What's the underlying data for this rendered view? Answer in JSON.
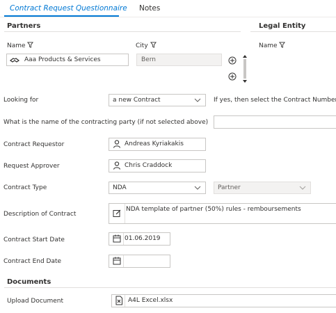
{
  "tabs": [
    {
      "label": "Contract Request Questionnaire",
      "active": true
    },
    {
      "label": "Notes",
      "active": false
    }
  ],
  "partners": {
    "title": "Partners",
    "columns": {
      "name": "Name",
      "city": "City"
    },
    "row": {
      "name": "Aaa Products & Services",
      "city": "Bern"
    }
  },
  "legal_entity": {
    "title": "Legal Entity",
    "columns": {
      "name": "Name"
    }
  },
  "form": {
    "looking_for": {
      "label": "Looking for",
      "value": "a new Contract",
      "hint": "If yes, then select the Contract Number"
    },
    "contracting_party": {
      "label": "What is the name of the contracting party (if not selected above)",
      "value": ""
    },
    "requestor": {
      "label": "Contract Requestor",
      "value": "Andreas Kyriakakis"
    },
    "approver": {
      "label": "Request Approver",
      "value": "Chris Craddock"
    },
    "contract_type": {
      "label": "Contract Type",
      "value": "NDA",
      "secondary_value": "Partner"
    },
    "description": {
      "label": "Description of Contract",
      "value": "NDA template of partner (50%) rules - remboursements"
    },
    "start_date": {
      "label": "Contract Start Date",
      "value": "01.06.2019"
    },
    "end_date": {
      "label": "Contract End Date",
      "value": ""
    }
  },
  "documents": {
    "title": "Documents",
    "upload_label": "Upload Document",
    "file_name": "A4L Excel.xlsx"
  },
  "colors": {
    "accent": "#0078d4",
    "border": "#c8c6c4",
    "disabled_bg": "#f3f2f1"
  },
  "icons": [
    "filter-icon",
    "partner-icon",
    "add-icon",
    "person-icon",
    "chevron-down-icon",
    "edit-icon",
    "calendar-icon",
    "excel-file-icon"
  ]
}
